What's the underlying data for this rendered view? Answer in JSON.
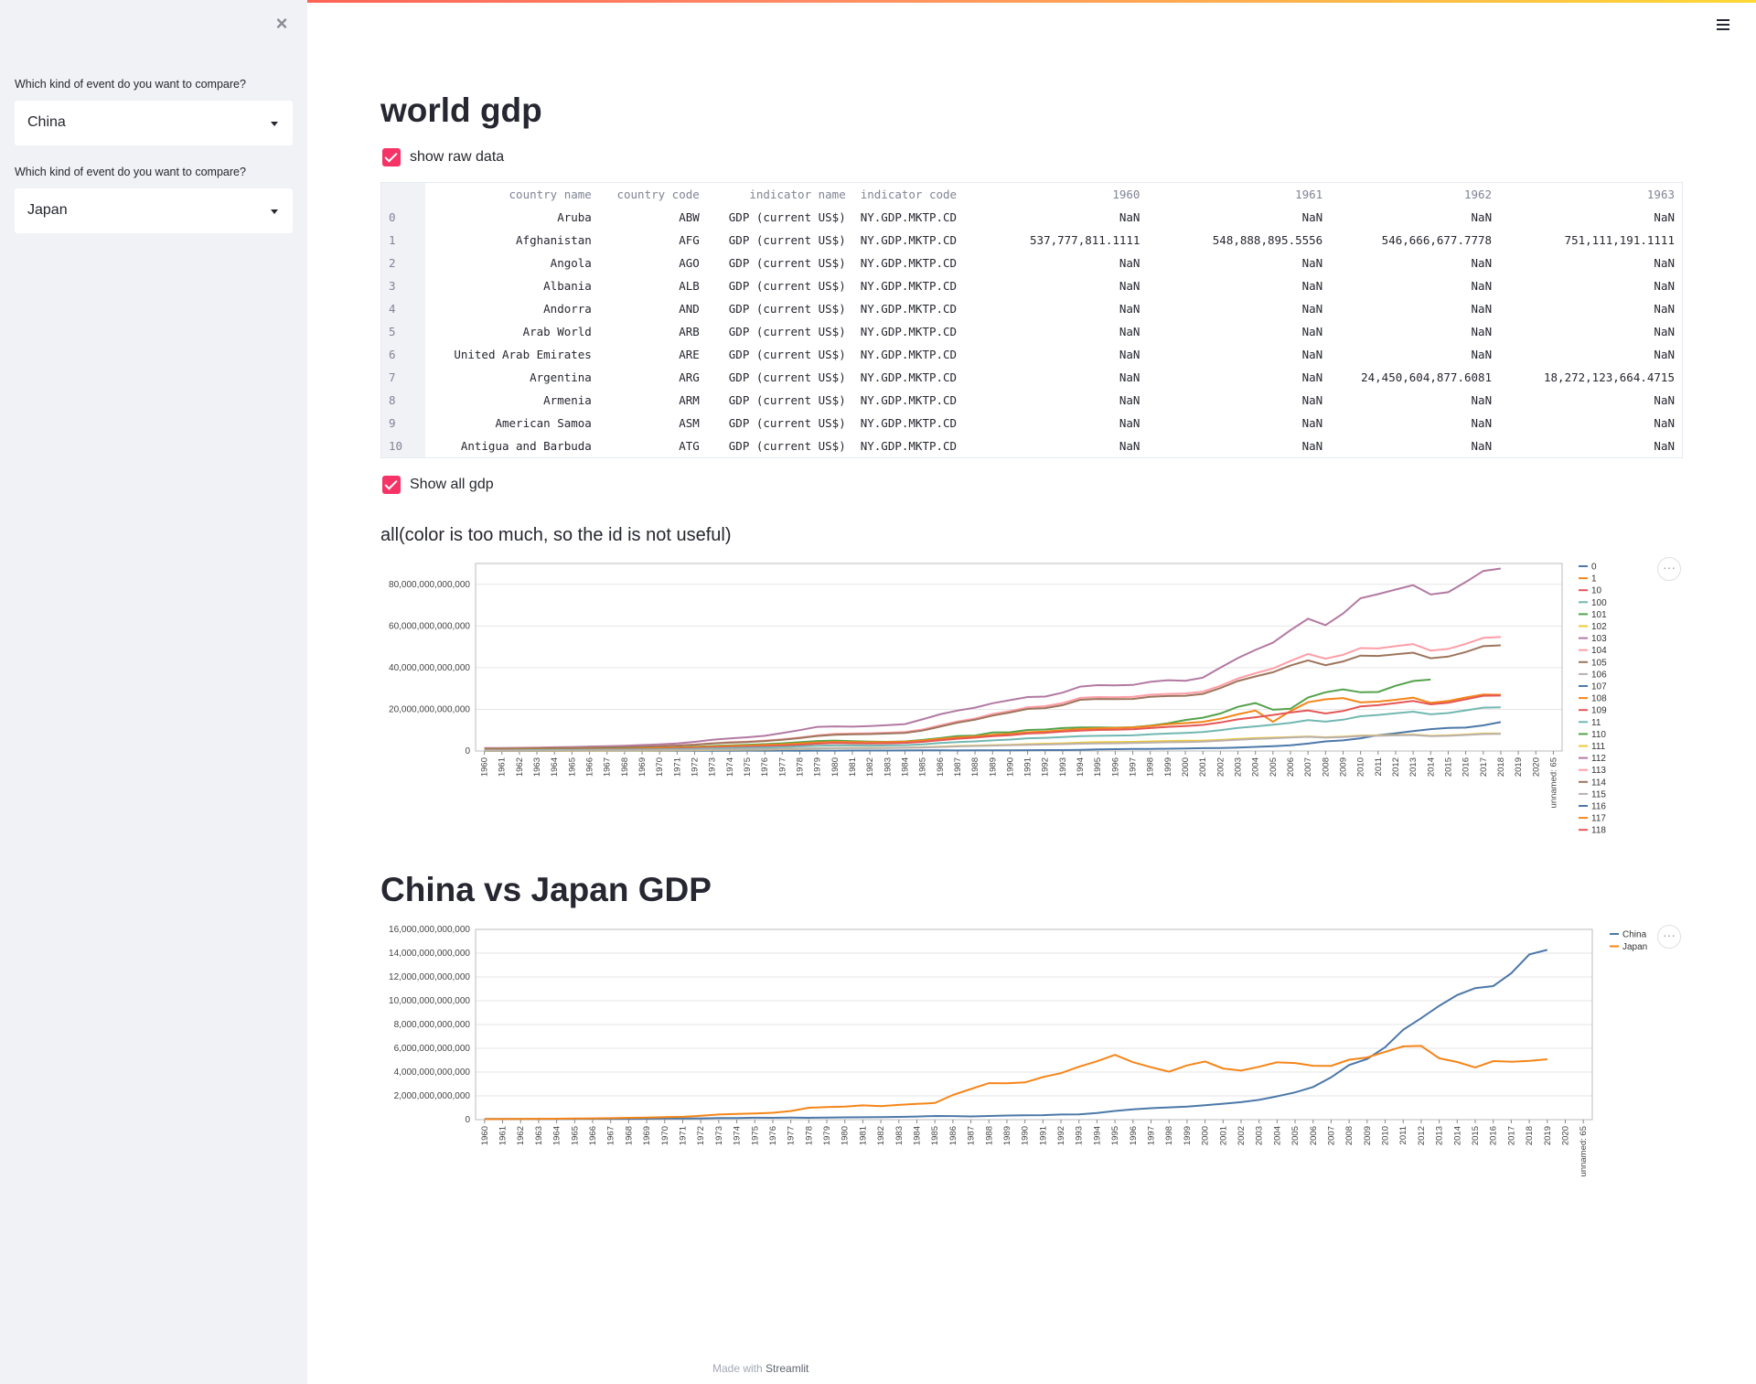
{
  "sidebar": {
    "close_icon": "close-icon",
    "select1": {
      "label": "Which kind of event do you want to compare?",
      "value": "China"
    },
    "select2": {
      "label": "Which kind of event do you want to compare?",
      "value": "Japan"
    }
  },
  "header": {
    "menu_icon": "hamburger-menu-icon"
  },
  "main": {
    "title": "world gdp",
    "checkbox_raw": {
      "label": "show raw data",
      "checked": true
    },
    "checkbox_all": {
      "label": "Show all gdp",
      "checked": true
    },
    "chart1_subtitle": "all(color is too much, so the id is not useful)",
    "compare_title": "China vs Japan GDP",
    "footer_prefix": "Made with ",
    "footer_brand": "Streamlit"
  },
  "table": {
    "columns": [
      "country name",
      "country code",
      "indicator name",
      "indicator code",
      "1960",
      "1961",
      "1962",
      "1963"
    ],
    "rows": [
      [
        "0",
        "Aruba",
        "ABW",
        "GDP (current US$)",
        "NY.GDP.MKTP.CD",
        "NaN",
        "NaN",
        "NaN",
        "NaN"
      ],
      [
        "1",
        "Afghanistan",
        "AFG",
        "GDP (current US$)",
        "NY.GDP.MKTP.CD",
        "537,777,811.1111",
        "548,888,895.5556",
        "546,666,677.7778",
        "751,111,191.1111"
      ],
      [
        "2",
        "Angola",
        "AGO",
        "GDP (current US$)",
        "NY.GDP.MKTP.CD",
        "NaN",
        "NaN",
        "NaN",
        "NaN"
      ],
      [
        "3",
        "Albania",
        "ALB",
        "GDP (current US$)",
        "NY.GDP.MKTP.CD",
        "NaN",
        "NaN",
        "NaN",
        "NaN"
      ],
      [
        "4",
        "Andorra",
        "AND",
        "GDP (current US$)",
        "NY.GDP.MKTP.CD",
        "NaN",
        "NaN",
        "NaN",
        "NaN"
      ],
      [
        "5",
        "Arab World",
        "ARB",
        "GDP (current US$)",
        "NY.GDP.MKTP.CD",
        "NaN",
        "NaN",
        "NaN",
        "NaN"
      ],
      [
        "6",
        "United Arab Emirates",
        "ARE",
        "GDP (current US$)",
        "NY.GDP.MKTP.CD",
        "NaN",
        "NaN",
        "NaN",
        "NaN"
      ],
      [
        "7",
        "Argentina",
        "ARG",
        "GDP (current US$)",
        "NY.GDP.MKTP.CD",
        "NaN",
        "NaN",
        "24,450,604,877.6081",
        "18,272,123,664.4715"
      ],
      [
        "8",
        "Armenia",
        "ARM",
        "GDP (current US$)",
        "NY.GDP.MKTP.CD",
        "NaN",
        "NaN",
        "NaN",
        "NaN"
      ],
      [
        "9",
        "American Samoa",
        "ASM",
        "GDP (current US$)",
        "NY.GDP.MKTP.CD",
        "NaN",
        "NaN",
        "NaN",
        "NaN"
      ],
      [
        "10",
        "Antigua and Barbuda",
        "ATG",
        "GDP (current US$)",
        "NY.GDP.MKTP.CD",
        "NaN",
        "NaN",
        "NaN",
        "NaN"
      ]
    ]
  },
  "chart_data": [
    {
      "type": "line",
      "title": "all(color is too much, so the id is not useful)",
      "xlabel": "",
      "ylabel": "",
      "x_start": 1960,
      "x_end": 2019,
      "x_extra_ticks": [
        "2020",
        "unnamed: 65"
      ],
      "ylim": [
        0,
        90000000000000
      ],
      "yticks": [
        0,
        20000000000000,
        40000000000000,
        60000000000000,
        80000000000000
      ],
      "ytick_labels": [
        "0",
        "20,000,000,000,000",
        "40,000,000,000,000",
        "60,000,000,000,000",
        "80,000,000,000,000"
      ],
      "legend_position": "right",
      "legend": [
        {
          "name": "0",
          "color": "#4c78a8"
        },
        {
          "name": "1",
          "color": "#f58518"
        },
        {
          "name": "10",
          "color": "#e45756"
        },
        {
          "name": "100",
          "color": "#72b7b2"
        },
        {
          "name": "101",
          "color": "#54a24b"
        },
        {
          "name": "102",
          "color": "#eeca3b"
        },
        {
          "name": "103",
          "color": "#b279a2"
        },
        {
          "name": "104",
          "color": "#ff9da6"
        },
        {
          "name": "105",
          "color": "#9d755d"
        },
        {
          "name": "106",
          "color": "#bab0ac"
        },
        {
          "name": "107",
          "color": "#4c78a8"
        },
        {
          "name": "108",
          "color": "#f58518"
        },
        {
          "name": "109",
          "color": "#e45756"
        },
        {
          "name": "11",
          "color": "#72b7b2"
        },
        {
          "name": "110",
          "color": "#54a24b"
        },
        {
          "name": "111",
          "color": "#eeca3b"
        },
        {
          "name": "112",
          "color": "#b279a2"
        },
        {
          "name": "113",
          "color": "#ff9da6"
        },
        {
          "name": "114",
          "color": "#9d755d"
        },
        {
          "name": "115",
          "color": "#bab0ac"
        },
        {
          "name": "116",
          "color": "#4c78a8"
        },
        {
          "name": "117",
          "color": "#f58518"
        },
        {
          "name": "118",
          "color": "#e45756"
        }
      ],
      "series": [
        {
          "color": "#b279a2",
          "values": [
            1.4,
            1.45,
            1.55,
            1.65,
            1.8,
            1.95,
            2.15,
            2.3,
            2.55,
            2.85,
            3.2,
            3.6,
            4.4,
            5.4,
            6.0,
            6.6,
            7.3,
            8.6,
            10.0,
            11.6,
            11.8,
            11.7,
            12.0,
            12.4,
            12.9,
            15.2,
            17.6,
            19.4,
            20.8,
            22.9,
            24.4,
            25.9,
            26.1,
            28.0,
            30.9,
            31.6,
            31.5,
            31.7,
            33.2,
            34.0,
            33.7,
            35.2,
            40.0,
            44.6,
            48.5,
            52.0,
            58.0,
            63.5,
            60.4,
            66.0,
            73.3,
            75.3,
            77.5,
            79.6,
            75.1,
            76.2,
            81.1,
            86.4,
            87.6
          ]
        },
        {
          "color": "#ff9da6",
          "values": [
            1.2,
            1.25,
            1.3,
            1.4,
            1.5,
            1.6,
            1.7,
            1.8,
            1.9,
            2.1,
            2.4,
            2.7,
            3.1,
            3.7,
            4.2,
            4.5,
            5.0,
            5.6,
            6.5,
            7.5,
            8.2,
            8.4,
            8.5,
            8.8,
            9.1,
            10.3,
            12.3,
            14.2,
            15.6,
            17.8,
            19.2,
            21.0,
            21.5,
            23.0,
            25.5,
            25.9,
            25.8,
            26.0,
            27.0,
            27.4,
            27.6,
            28.5,
            31.3,
            34.8,
            37.3,
            39.6,
            43.2,
            46.6,
            44.3,
            46.2,
            49.4,
            49.2,
            50.3,
            51.3,
            48.2,
            49.0,
            51.4,
            54.3,
            54.7
          ]
        },
        {
          "color": "#9d755d",
          "values": [
            1.1,
            1.15,
            1.2,
            1.3,
            1.4,
            1.5,
            1.6,
            1.7,
            1.8,
            2.0,
            2.3,
            2.6,
            3.0,
            3.6,
            4.0,
            4.3,
            4.8,
            5.4,
            6.2,
            7.2,
            7.8,
            8.0,
            8.1,
            8.4,
            8.7,
            9.8,
            11.7,
            13.6,
            15.0,
            17.0,
            18.5,
            20.2,
            20.6,
            22.0,
            24.6,
            25.0,
            24.9,
            25.0,
            26.0,
            26.4,
            26.5,
            27.4,
            30.2,
            33.6,
            35.8,
            37.8,
            41.0,
            43.5,
            41.2,
            43.0,
            45.8,
            45.6,
            46.4,
            47.2,
            44.5,
            45.3,
            47.5,
            50.3,
            50.7
          ]
        },
        {
          "color": "#54a24b",
          "values": [
            0.6,
            0.62,
            0.65,
            0.7,
            0.75,
            0.8,
            0.9,
            1.0,
            1.1,
            1.3,
            1.5,
            1.7,
            2.0,
            2.4,
            2.7,
            3.0,
            3.3,
            3.7,
            4.2,
            4.8,
            5.0,
            4.7,
            4.5,
            4.4,
            4.6,
            5.3,
            6.2,
            7.2,
            7.4,
            8.9,
            9.0,
            10.1,
            10.3,
            11.0,
            11.3,
            11.3,
            11.2,
            11.4,
            12.2,
            13.3,
            14.9,
            16.0,
            18.0,
            21.2,
            23.0,
            19.8,
            20.3,
            25.7,
            28.2,
            29.6,
            28.2,
            28.3,
            31.3,
            33.6,
            34.3
          ]
        },
        {
          "color": "#f58518",
          "values": [
            0.5,
            0.52,
            0.55,
            0.6,
            0.65,
            0.7,
            0.8,
            0.9,
            1.0,
            1.2,
            1.4,
            1.6,
            1.8,
            2.1,
            2.4,
            2.6,
            2.9,
            3.2,
            3.6,
            4.1,
            4.4,
            4.3,
            4.2,
            4.3,
            4.5,
            5.0,
            5.8,
            6.5,
            7.0,
            7.8,
            8.2,
            9.0,
            9.3,
            10.0,
            10.6,
            10.9,
            11.0,
            11.3,
            12.0,
            12.8,
            13.4,
            14.0,
            15.5,
            17.6,
            19.4,
            14.0,
            19.2,
            23.4,
            24.8,
            25.4,
            23.3,
            23.7,
            24.6,
            25.6,
            23.1,
            24.0,
            25.7,
            27.1,
            27.0
          ]
        },
        {
          "color": "#e45756",
          "values": [
            0.4,
            0.42,
            0.45,
            0.5,
            0.55,
            0.6,
            0.65,
            0.7,
            0.8,
            0.9,
            1.0,
            1.2,
            1.4,
            1.7,
            1.9,
            2.1,
            2.3,
            2.6,
            3.0,
            3.5,
            3.8,
            3.7,
            3.6,
            3.7,
            3.9,
            4.4,
            5.2,
            5.9,
            6.4,
            7.1,
            7.6,
            8.4,
            8.7,
            9.3,
            9.8,
            10.1,
            10.2,
            10.4,
            11.0,
            11.6,
            12.0,
            12.5,
            13.7,
            15.2,
            16.2,
            17.3,
            18.5,
            19.5,
            18.0,
            19.2,
            21.4,
            22.0,
            23.0,
            24.0,
            22.4,
            23.2,
            24.8,
            26.5,
            26.6
          ]
        },
        {
          "color": "#72b7b2",
          "values": [
            0.35,
            0.37,
            0.4,
            0.43,
            0.47,
            0.5,
            0.55,
            0.6,
            0.65,
            0.72,
            0.8,
            0.9,
            1.05,
            1.25,
            1.4,
            1.55,
            1.7,
            1.9,
            2.2,
            2.5,
            2.7,
            2.7,
            2.6,
            2.7,
            2.8,
            3.2,
            3.8,
            4.3,
            4.6,
            5.1,
            5.5,
            6.1,
            6.3,
            6.7,
            7.1,
            7.3,
            7.4,
            7.5,
            8.0,
            8.4,
            8.7,
            9.1,
            10.0,
            11.1,
            11.8,
            12.6,
            13.5,
            14.8,
            14.1,
            15.0,
            16.7,
            17.3,
            18.1,
            18.9,
            17.6,
            18.2,
            19.5,
            20.8,
            21.0
          ]
        },
        {
          "color": "#4c78a8",
          "values": [
            0.06,
            0.05,
            0.05,
            0.05,
            0.06,
            0.07,
            0.08,
            0.07,
            0.07,
            0.08,
            0.09,
            0.1,
            0.11,
            0.14,
            0.14,
            0.16,
            0.15,
            0.17,
            0.15,
            0.18,
            0.19,
            0.2,
            0.21,
            0.23,
            0.26,
            0.31,
            0.3,
            0.27,
            0.31,
            0.35,
            0.36,
            0.38,
            0.43,
            0.44,
            0.56,
            0.73,
            0.86,
            0.96,
            1.03,
            1.09,
            1.21,
            1.34,
            1.47,
            1.66,
            1.96,
            2.29,
            2.75,
            3.55,
            4.59,
            5.1,
            6.09,
            7.55,
            8.53,
            9.57,
            10.48,
            11.06,
            11.23,
            12.31,
            13.89
          ]
        },
        {
          "color": "#eeca3b",
          "values": [
            0.1,
            0.11,
            0.12,
            0.13,
            0.14,
            0.15,
            0.17,
            0.19,
            0.21,
            0.24,
            0.28,
            0.32,
            0.38,
            0.48,
            0.56,
            0.64,
            0.72,
            0.86,
            1.04,
            1.24,
            1.38,
            1.41,
            1.44,
            1.48,
            1.55,
            1.8,
            2.1,
            2.4,
            2.6,
            2.8,
            3.0,
            3.3,
            3.5,
            3.7,
            4.0,
            4.2,
            4.3,
            4.4,
            4.6,
            4.8,
            4.9,
            5.0,
            5.3,
            5.8,
            6.2,
            6.4,
            6.7,
            7.0,
            6.6,
            6.9,
            7.4,
            7.5,
            7.7,
            7.9,
            7.3,
            7.5,
            7.9,
            8.4,
            8.4
          ]
        },
        {
          "color": "#bab0ac",
          "values": [
            0.2,
            0.21,
            0.22,
            0.24,
            0.26,
            0.28,
            0.3,
            0.33,
            0.36,
            0.4,
            0.45,
            0.5,
            0.57,
            0.67,
            0.75,
            0.82,
            0.9,
            1.0,
            1.15,
            1.3,
            1.4,
            1.42,
            1.45,
            1.5,
            1.57,
            1.72,
            1.95,
            2.2,
            2.4,
            2.6,
            2.8,
            3.0,
            3.1,
            3.3,
            3.5,
            3.6,
            3.7,
            3.8,
            4.0,
            4.2,
            4.3,
            4.5,
            4.9,
            5.4,
            5.8,
            6.1,
            6.5,
            6.8,
            6.4,
            6.7,
            7.2,
            7.3,
            7.5,
            7.7,
            7.1,
            7.3,
            7.7,
            8.1,
            8.2
          ]
        }
      ]
    },
    {
      "type": "line",
      "title": "China vs Japan GDP",
      "xlabel": "",
      "ylabel": "",
      "x_start": 1960,
      "x_end": 2019,
      "x_extra_ticks": [
        "2020",
        "unnamed: 65"
      ],
      "ylim": [
        0,
        16000000000000
      ],
      "yticks": [
        0,
        2000000000000,
        4000000000000,
        6000000000000,
        8000000000000,
        10000000000000,
        12000000000000,
        14000000000000,
        16000000000000
      ],
      "ytick_labels": [
        "0",
        "2,000,000,000,000",
        "4,000,000,000,000",
        "6,000,000,000,000",
        "8,000,000,000,000",
        "10,000,000,000,000",
        "12,000,000,000,000",
        "14,000,000,000,000",
        "16,000,000,000,000"
      ],
      "legend_position": "top-right",
      "series": [
        {
          "name": "China",
          "color": "#4c78a8",
          "values": [
            0.06,
            0.05,
            0.05,
            0.05,
            0.06,
            0.07,
            0.08,
            0.07,
            0.07,
            0.08,
            0.09,
            0.1,
            0.11,
            0.14,
            0.14,
            0.16,
            0.15,
            0.17,
            0.15,
            0.18,
            0.19,
            0.2,
            0.21,
            0.23,
            0.26,
            0.31,
            0.3,
            0.27,
            0.31,
            0.35,
            0.36,
            0.38,
            0.43,
            0.44,
            0.56,
            0.73,
            0.86,
            0.96,
            1.03,
            1.09,
            1.21,
            1.34,
            1.47,
            1.66,
            1.96,
            2.29,
            2.75,
            3.55,
            4.59,
            5.1,
            6.09,
            7.55,
            8.53,
            9.57,
            10.48,
            11.06,
            11.23,
            12.31,
            13.89,
            14.28
          ]
        },
        {
          "name": "Japan",
          "color": "#f58518",
          "values": [
            0.04,
            0.05,
            0.06,
            0.07,
            0.08,
            0.09,
            0.11,
            0.12,
            0.15,
            0.18,
            0.21,
            0.24,
            0.32,
            0.43,
            0.48,
            0.52,
            0.58,
            0.72,
            1.0,
            1.05,
            1.1,
            1.2,
            1.13,
            1.24,
            1.32,
            1.4,
            2.08,
            2.58,
            3.07,
            3.05,
            3.13,
            3.58,
            3.91,
            4.45,
            4.91,
            5.45,
            4.83,
            4.41,
            4.03,
            4.56,
            4.89,
            4.3,
            4.12,
            4.45,
            4.82,
            4.76,
            4.53,
            4.52,
            5.04,
            5.23,
            5.7,
            6.16,
            6.2,
            5.16,
            4.85,
            4.39,
            4.92,
            4.87,
            4.95,
            5.08
          ]
        }
      ]
    }
  ]
}
